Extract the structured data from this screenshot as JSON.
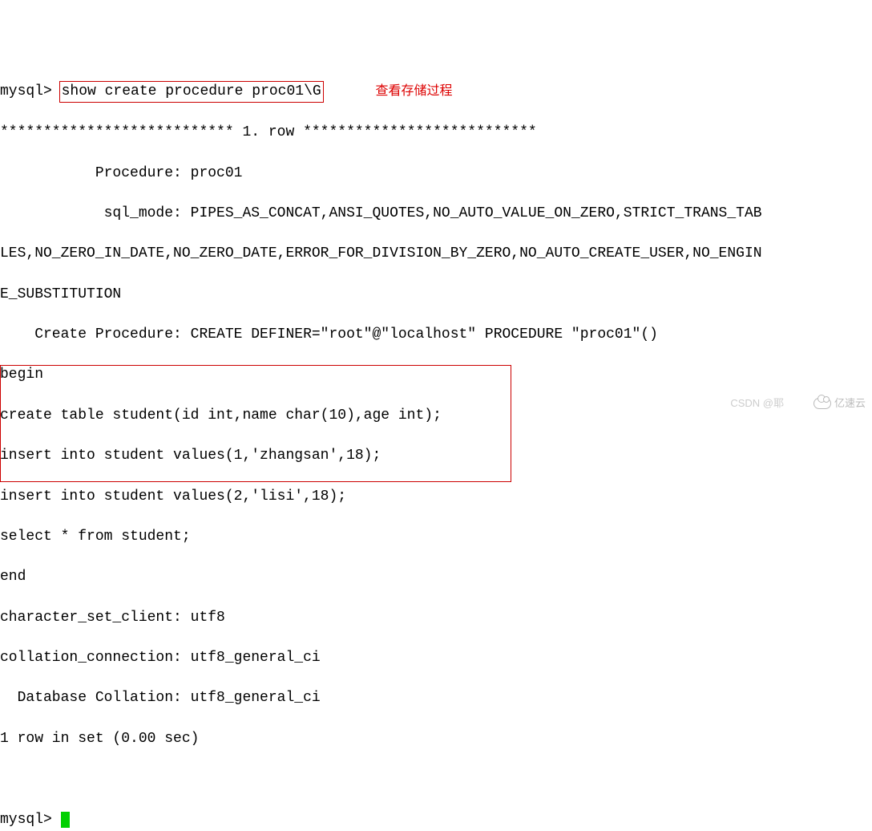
{
  "prompt1": "mysql> ",
  "command": "show create procedure proc01\\G",
  "annotation": "查看存储过程",
  "row_sep_left": "*************************** ",
  "row_sep_mid": "1. row",
  "row_sep_right": " ***************************",
  "procedure_label": "           Procedure: ",
  "procedure_value": "proc01",
  "sql_mode_label": "            sql_mode: ",
  "sql_mode_line1": "PIPES_AS_CONCAT,ANSI_QUOTES,NO_AUTO_VALUE_ON_ZERO,STRICT_TRANS_TAB",
  "sql_mode_line2": "LES,NO_ZERO_IN_DATE,NO_ZERO_DATE,ERROR_FOR_DIVISION_BY_ZERO,NO_AUTO_CREATE_USER,NO_ENGIN",
  "sql_mode_line3": "E_SUBSTITUTION",
  "create_proc_label": "    Create Procedure: ",
  "create_proc_value": "CREATE DEFINER=\"root\"@\"localhost\" PROCEDURE \"proc01\"()",
  "body_begin": "begin",
  "body_create_table": "create table student(id int,name char(10),age int);",
  "body_insert1": "insert into student values(1,'zhangsan',18);",
  "body_insert2": "insert into student values(2,'lisi',18);",
  "body_select": "select * from student;",
  "body_end": "end",
  "charset_label": "character_set_client: ",
  "charset_value": "utf8",
  "collation_conn_label": "collation_connection: ",
  "collation_conn_value": "utf8_general_ci",
  "db_collation_label": "  Database Collation: ",
  "db_collation_value": "utf8_general_ci",
  "rows_msg": "1 row in set (0.00 sec)",
  "prompt2": "mysql> ",
  "watermark_csdn": "CSDN @耶",
  "watermark_brand": "亿速云"
}
